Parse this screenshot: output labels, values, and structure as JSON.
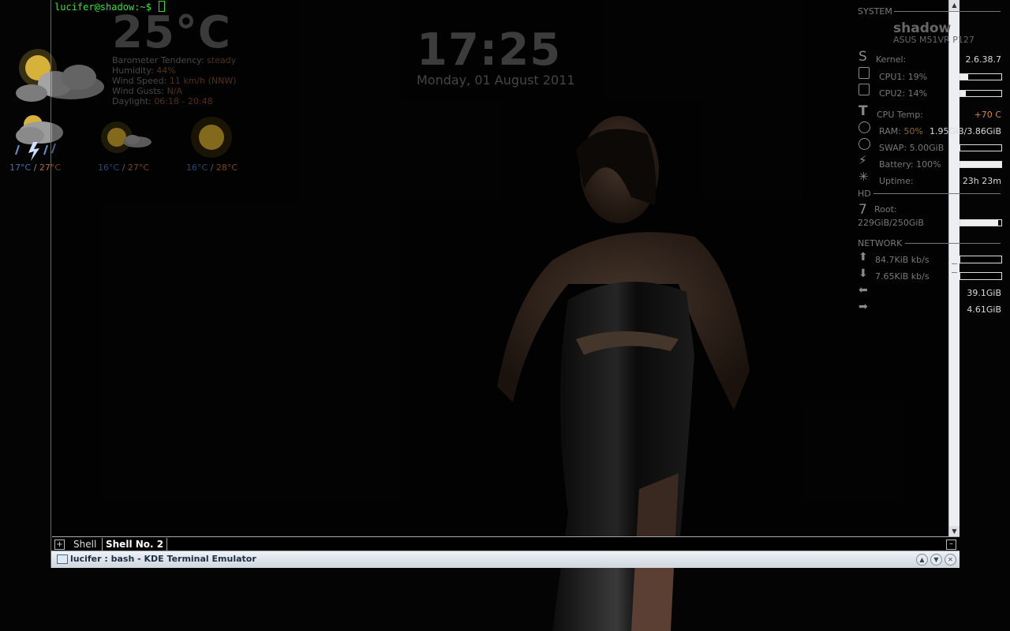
{
  "weather": {
    "current_temp": "25°C",
    "details": [
      {
        "label": "Barometer Tendency:",
        "value": "steady"
      },
      {
        "label": "Humidity:",
        "value": "44%"
      },
      {
        "label": "Wind Speed:",
        "value": "11 km/h (NNW)"
      },
      {
        "label": "Wind Gusts:",
        "value": "N/A"
      },
      {
        "label": "Daylight:",
        "value": "06:18 - 20:48"
      }
    ],
    "forecast": [
      {
        "low": "17°C",
        "high": "27°C",
        "icon": "thunderstorm-icon"
      },
      {
        "low": "16°C",
        "high": "27°C",
        "icon": "sun-cloud-icon"
      },
      {
        "low": "16°C",
        "high": "28°C",
        "icon": "sun-icon"
      }
    ],
    "separator": "/"
  },
  "clock": {
    "time": "17:25",
    "date": "Monday, 01 August 2011"
  },
  "terminal": {
    "prompt": "lucifer@shadow:~$",
    "tabs": [
      "Shell",
      "Shell No. 2"
    ],
    "active_tab": 1,
    "window_title": "lucifer : bash - KDE Terminal Emulator"
  },
  "system": {
    "section_system": "SYSTEM",
    "hostname": "shadow",
    "model": "ASUS M51VR P127",
    "kernel_label": "Kernel:",
    "kernel_value": "2.6.38.7",
    "cpu1_label": "CPU1: 19%",
    "cpu1_fraction": 0.19,
    "cpu2_label": "CPU2: 14%",
    "cpu2_fraction": 0.14,
    "cputemp_label": "CPU Temp:",
    "cputemp_value": "+70 C",
    "ram_label": "RAM:",
    "ram_pct": "50%",
    "ram_value": "1.95GiB/3.86GiB",
    "swap_label": "SWAP: 5.00GiB",
    "swap_fraction": 0.0,
    "battery_label": "Battery: 100%",
    "battery_fraction": 1.0,
    "uptime_label": "Uptime:",
    "uptime_value": "23h 23m",
    "section_hd": "HD",
    "root_label": "Root:",
    "root_value": "229GiB/250GiB",
    "root_fraction": 0.92,
    "section_network": "NETWORK",
    "up_speed": "84.7KiB kb/s",
    "down_speed": "7.65KiB kb/s",
    "total_down": "39.1GiB",
    "total_up": "4.61GiB"
  },
  "colors": {
    "prompt": "#3cdc3c",
    "accent_orange": "#b06a2a",
    "accent_blue": "#3b6fb0"
  }
}
